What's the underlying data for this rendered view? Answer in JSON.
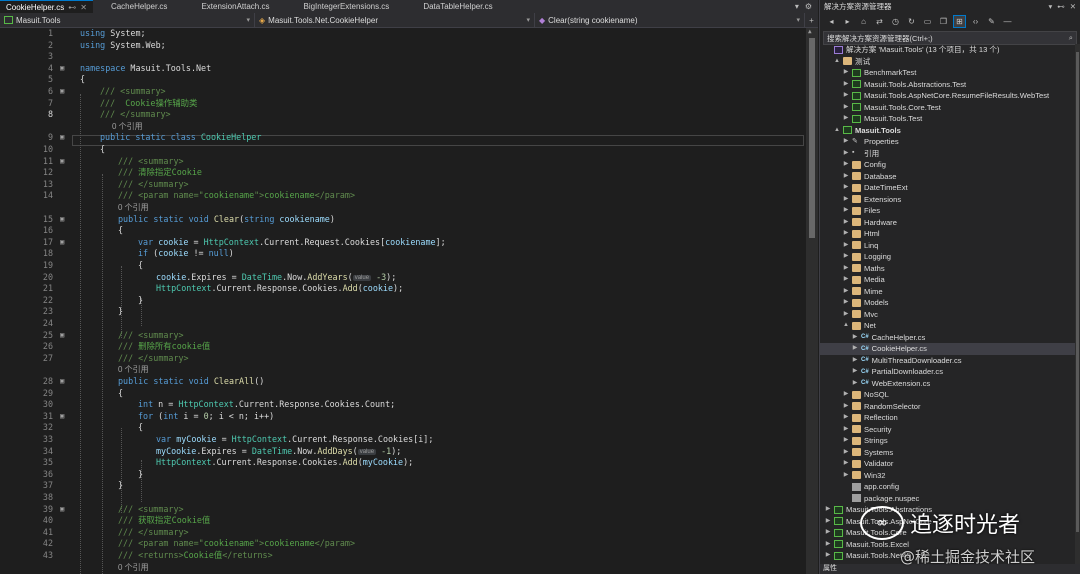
{
  "tabs": [
    {
      "label": "CookieHelper.cs",
      "active": true
    },
    {
      "label": "CacheHelper.cs"
    },
    {
      "label": "ExtensionAttach.cs"
    },
    {
      "label": "BigIntegerExtensions.cs"
    },
    {
      "label": "DataTableHelper.cs"
    }
  ],
  "nav": {
    "project": "Masuit.Tools",
    "type": "Masuit.Tools.Net.CookieHelper",
    "member": "Clear(string cookiename)"
  },
  "ref_text": "0 个引用",
  "hint_value": "value",
  "code_lines": [
    {
      "n": "1"
    },
    {
      "n": "2"
    },
    {
      "n": "3"
    },
    {
      "n": "4"
    },
    {
      "n": "5"
    },
    {
      "n": "6"
    },
    {
      "n": "7"
    },
    {
      "n": "8"
    },
    {
      "n": "9"
    },
    {
      "n": "10"
    },
    {
      "n": "11"
    },
    {
      "n": "12"
    },
    {
      "n": "13"
    },
    {
      "n": "14"
    },
    {
      "n": "15"
    },
    {
      "n": "16"
    },
    {
      "n": "17"
    },
    {
      "n": "18"
    },
    {
      "n": "19"
    },
    {
      "n": "20"
    },
    {
      "n": "21"
    },
    {
      "n": "22"
    },
    {
      "n": "23"
    },
    {
      "n": "24"
    },
    {
      "n": "25"
    },
    {
      "n": "26"
    },
    {
      "n": "27"
    },
    {
      "n": "28"
    },
    {
      "n": "29"
    },
    {
      "n": "30"
    },
    {
      "n": "31"
    },
    {
      "n": "32"
    },
    {
      "n": "33"
    },
    {
      "n": "34"
    },
    {
      "n": "35"
    },
    {
      "n": "36"
    },
    {
      "n": "37"
    },
    {
      "n": "38"
    },
    {
      "n": "39"
    },
    {
      "n": "40"
    },
    {
      "n": "41"
    },
    {
      "n": "42"
    },
    {
      "n": "43"
    }
  ],
  "code": {
    "l1": [
      "using",
      " System;"
    ],
    "l2": [
      "using",
      " System.Web;"
    ],
    "l4": [
      "namespace",
      " Masuit.Tools.Net"
    ],
    "l5": "{",
    "l6": [
      "/// <summary>"
    ],
    "l7": [
      "///  ",
      "Cookie操作辅助类"
    ],
    "l8": [
      "/// </summary>"
    ],
    "l9": [
      "public",
      " ",
      "static",
      " ",
      "class",
      " ",
      "CookieHelper"
    ],
    "l10": "{",
    "l11": "/// <summary>",
    "l12": [
      "/// ",
      "清除指定Cookie"
    ],
    "l13": "/// </summary>",
    "l14": [
      "/// <param name=\"",
      "cookiename",
      "\">",
      "cookiename",
      "</param>"
    ],
    "l15": [
      "public",
      " ",
      "static",
      " ",
      "void",
      " ",
      "Clear",
      "(",
      "string",
      " ",
      "cookiename",
      ")"
    ],
    "l16": "{",
    "l17": [
      "var",
      " ",
      "cookie",
      " = ",
      "HttpContext",
      ".Current.Request.Cookies[",
      "cookiename",
      "];"
    ],
    "l18": [
      "if",
      " (",
      "cookie",
      " != ",
      "null",
      ")"
    ],
    "l19": "{",
    "l20": [
      "cookie",
      ".Expires = ",
      "DateTime",
      ".Now.",
      "AddYears",
      "(",
      "-3",
      ");"
    ],
    "l21": [
      "HttpContext",
      ".Current.Response.Cookies.",
      "Add",
      "(",
      "cookie",
      ");"
    ],
    "l22": "}",
    "l23": "}",
    "l25": "/// <summary>",
    "l26": [
      "/// ",
      "删除所有cookie值"
    ],
    "l27": "/// </summary>",
    "l28": [
      "public",
      " ",
      "static",
      " ",
      "void",
      " ",
      "ClearAll",
      "()"
    ],
    "l29": "{",
    "l30": [
      "int",
      " n = ",
      "HttpContext",
      ".Current.Response.Cookies.Count;"
    ],
    "l31": [
      "for",
      " (",
      "int",
      " i = ",
      "0",
      "; i < n; i++)"
    ],
    "l32": "{",
    "l33": [
      "var",
      " ",
      "myCookie",
      " = ",
      "HttpContext",
      ".Current.Response.Cookies[i];"
    ],
    "l34": [
      "myCookie",
      ".Expires = ",
      "DateTime",
      ".Now.",
      "AddDays",
      "(",
      "-1",
      ");"
    ],
    "l35": [
      "HttpContext",
      ".Current.Response.Cookies.",
      "Add",
      "(",
      "myCookie",
      ");"
    ],
    "l36": "}",
    "l37": "}",
    "l39": "/// <summary>",
    "l40": [
      "/// ",
      "获取指定Cookie值"
    ],
    "l41": "/// </summary>",
    "l42": [
      "/// <param name=\"",
      "cookiename",
      "\">",
      "cookiename",
      "</param>"
    ],
    "l43": [
      "/// <returns>",
      "Cookie值",
      "</returns>"
    ]
  },
  "solution": {
    "title": "解决方案资源管理器",
    "search_placeholder": "搜索解决方案资源管理器(Ctrl+;)",
    "root": "解决方案 'Masuit.Tools' (13 个项目，共 13 个)",
    "nodes": [
      {
        "label": "测试",
        "kind": "folder",
        "lvl": 1,
        "arrow": "▲"
      },
      {
        "label": "BenchmarkTest",
        "kind": "proj",
        "lvl": 2,
        "arrow": "▶"
      },
      {
        "label": "Masuit.Tools.Abstractions.Test",
        "kind": "proj",
        "lvl": 2,
        "arrow": "▶"
      },
      {
        "label": "Masuit.Tools.AspNetCore.ResumeFileResults.WebTest",
        "kind": "proj",
        "lvl": 2,
        "arrow": "▶"
      },
      {
        "label": "Masuit.Tools.Core.Test",
        "kind": "proj",
        "lvl": 2,
        "arrow": "▶"
      },
      {
        "label": "Masuit.Tools.Test",
        "kind": "proj",
        "lvl": 2,
        "arrow": "▶"
      },
      {
        "label": "Masuit.Tools",
        "kind": "proj",
        "lvl": 1,
        "arrow": "▲",
        "bold": true
      },
      {
        "label": "Properties",
        "kind": "wrench",
        "lvl": 2,
        "arrow": "▶"
      },
      {
        "label": "引用",
        "kind": "refs",
        "lvl": 2,
        "arrow": "▶"
      },
      {
        "label": "Config",
        "kind": "folder",
        "lvl": 2,
        "arrow": "▶"
      },
      {
        "label": "Database",
        "kind": "folder",
        "lvl": 2,
        "arrow": "▶"
      },
      {
        "label": "DateTimeExt",
        "kind": "folder",
        "lvl": 2,
        "arrow": "▶"
      },
      {
        "label": "Extensions",
        "kind": "folder",
        "lvl": 2,
        "arrow": "▶"
      },
      {
        "label": "Files",
        "kind": "folder",
        "lvl": 2,
        "arrow": "▶"
      },
      {
        "label": "Hardware",
        "kind": "folder",
        "lvl": 2,
        "arrow": "▶"
      },
      {
        "label": "Html",
        "kind": "folder",
        "lvl": 2,
        "arrow": "▶"
      },
      {
        "label": "Linq",
        "kind": "folder",
        "lvl": 2,
        "arrow": "▶"
      },
      {
        "label": "Logging",
        "kind": "folder",
        "lvl": 2,
        "arrow": "▶"
      },
      {
        "label": "Maths",
        "kind": "folder",
        "lvl": 2,
        "arrow": "▶"
      },
      {
        "label": "Media",
        "kind": "folder",
        "lvl": 2,
        "arrow": "▶"
      },
      {
        "label": "Mime",
        "kind": "folder",
        "lvl": 2,
        "arrow": "▶"
      },
      {
        "label": "Models",
        "kind": "folder",
        "lvl": 2,
        "arrow": "▶"
      },
      {
        "label": "Mvc",
        "kind": "folder",
        "lvl": 2,
        "arrow": "▶"
      },
      {
        "label": "Net",
        "kind": "folder",
        "lvl": 2,
        "arrow": "▲"
      },
      {
        "label": "CacheHelper.cs",
        "kind": "cs",
        "lvl": 3,
        "arrow": "▶"
      },
      {
        "label": "CookieHelper.cs",
        "kind": "cs",
        "lvl": 3,
        "arrow": "▶",
        "selected": true
      },
      {
        "label": "MultiThreadDownloader.cs",
        "kind": "cs",
        "lvl": 3,
        "arrow": "▶"
      },
      {
        "label": "PartialDownloader.cs",
        "kind": "cs",
        "lvl": 3,
        "arrow": "▶"
      },
      {
        "label": "WebExtension.cs",
        "kind": "cs",
        "lvl": 3,
        "arrow": "▶"
      },
      {
        "label": "NoSQL",
        "kind": "folder",
        "lvl": 2,
        "arrow": "▶"
      },
      {
        "label": "RandomSelector",
        "kind": "folder",
        "lvl": 2,
        "arrow": "▶"
      },
      {
        "label": "Reflection",
        "kind": "folder",
        "lvl": 2,
        "arrow": "▶"
      },
      {
        "label": "Security",
        "kind": "folder",
        "lvl": 2,
        "arrow": "▶"
      },
      {
        "label": "Strings",
        "kind": "folder",
        "lvl": 2,
        "arrow": "▶"
      },
      {
        "label": "Systems",
        "kind": "folder",
        "lvl": 2,
        "arrow": "▶"
      },
      {
        "label": "Validator",
        "kind": "folder",
        "lvl": 2,
        "arrow": "▶"
      },
      {
        "label": "Win32",
        "kind": "folder",
        "lvl": 2,
        "arrow": "▶"
      },
      {
        "label": "app.config",
        "kind": "cfg",
        "lvl": 2,
        "arrow": ""
      },
      {
        "label": "package.nuspec",
        "kind": "cfg",
        "lvl": 2,
        "arrow": ""
      },
      {
        "label": "Masuit.Tools.Abstractions",
        "kind": "proj",
        "lvl": 0,
        "arrow": "▶"
      },
      {
        "label": "Masuit.Tools.AspNetCore",
        "kind": "proj",
        "lvl": 0,
        "arrow": "▶"
      },
      {
        "label": "Masuit.Tools.Core",
        "kind": "proj",
        "lvl": 0,
        "arrow": "▶"
      },
      {
        "label": "Masuit.Tools.Excel",
        "kind": "proj",
        "lvl": 0,
        "arrow": "▶"
      },
      {
        "label": "Masuit.Tools.Net45",
        "kind": "proj",
        "lvl": 0,
        "arrow": "▶"
      }
    ],
    "bottom_label": "属性"
  },
  "watermark": {
    "line1": "追逐时光者",
    "line2": "@稀土掘金技术社区"
  }
}
